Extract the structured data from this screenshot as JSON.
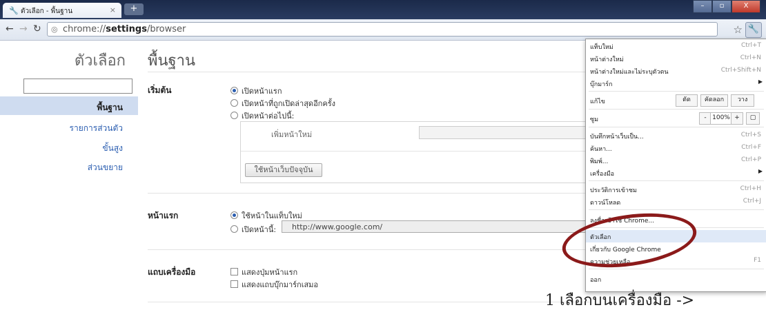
{
  "browser": {
    "tab_title": "ตัวเลือก - พื้นฐาน",
    "tab_icon": "wrench-icon",
    "tab_close": "×",
    "new_tab": "+",
    "url_prefix": "chrome://",
    "url_bold": "settings",
    "url_suffix": "/browser",
    "window_controls": [
      "–",
      "▫",
      "X"
    ]
  },
  "sidebar": {
    "title": "ตัวเลือก",
    "search_placeholder": "",
    "items": [
      {
        "label": "พื้นฐาน",
        "selected": true
      },
      {
        "label": "รายการส่วนตัว",
        "selected": false
      },
      {
        "label": "ขั้นสูง",
        "selected": false
      },
      {
        "label": "ส่วนขยาย",
        "selected": false
      }
    ]
  },
  "main": {
    "title": "พื้นฐาน",
    "startup": {
      "label": "เริ่มต้น",
      "options": [
        "เปิดหน้าแรก",
        "เปิดหน้าที่ถูกเปิดล่าสุดอีกครั้ง",
        "เปิดหน้าต่อไปนี้:"
      ],
      "selected": 0,
      "add_page": "เพิ่มหน้าใหม่",
      "use_current_button": "ใช้หน้าเว็บปัจจุบัน"
    },
    "homepage": {
      "label": "หน้าแรก",
      "options": [
        "ใช้หน้าในแท็บใหม่",
        "เปิดหน้านี้:"
      ],
      "selected": 0,
      "url": "http://www.google.com/"
    },
    "toolbar": {
      "label": "แถบเครื่องมือ",
      "options": [
        "แสดงปุ่มหน้าแรก",
        "แสดงแถบบุ๊กมาร์กเสมอ"
      ]
    }
  },
  "menu": {
    "items": [
      {
        "label": "แท็บใหม่",
        "shortcut": "Ctrl+T"
      },
      {
        "label": "หน้าต่างใหม่",
        "shortcut": "Ctrl+N"
      },
      {
        "label": "หน้าต่างใหม่และไม่ระบุตัวตน",
        "shortcut": "Ctrl+Shift+N"
      },
      {
        "label": "บุ๊กมาร์ก",
        "submenu": true
      },
      {
        "label": "แก้ไข",
        "buttons": [
          "ตัด",
          "คัดลอก",
          "วาง"
        ]
      },
      {
        "label": "ซูม",
        "zoom": {
          "minus": "-",
          "value": "100%",
          "plus": "+"
        }
      },
      {
        "label": "บันทึกหน้าเว็บเป็น...",
        "shortcut": "Ctrl+S"
      },
      {
        "label": "ค้นหา...",
        "shortcut": "Ctrl+F"
      },
      {
        "label": "พิมพ์...",
        "shortcut": "Ctrl+P"
      },
      {
        "label": "เครื่องมือ",
        "submenu": true
      },
      {
        "label": "ประวัติการเข้าชม",
        "shortcut": "Ctrl+H"
      },
      {
        "label": "ดาวน์โหลด",
        "shortcut": "Ctrl+J"
      },
      {
        "label": "ลงชื่อเข้าใช้ Chrome..."
      },
      {
        "label": "ตัวเลือก",
        "highlighted": true
      },
      {
        "label": "เกี่ยวกับ Google Chrome"
      },
      {
        "label": "ความช่วยเหลือ",
        "shortcut": "F1"
      },
      {
        "label": "ออก"
      }
    ]
  },
  "annotation": {
    "caption": "1    เลือกบนเครื่องมือ ->",
    "oval_color": "#8b1a1a"
  }
}
